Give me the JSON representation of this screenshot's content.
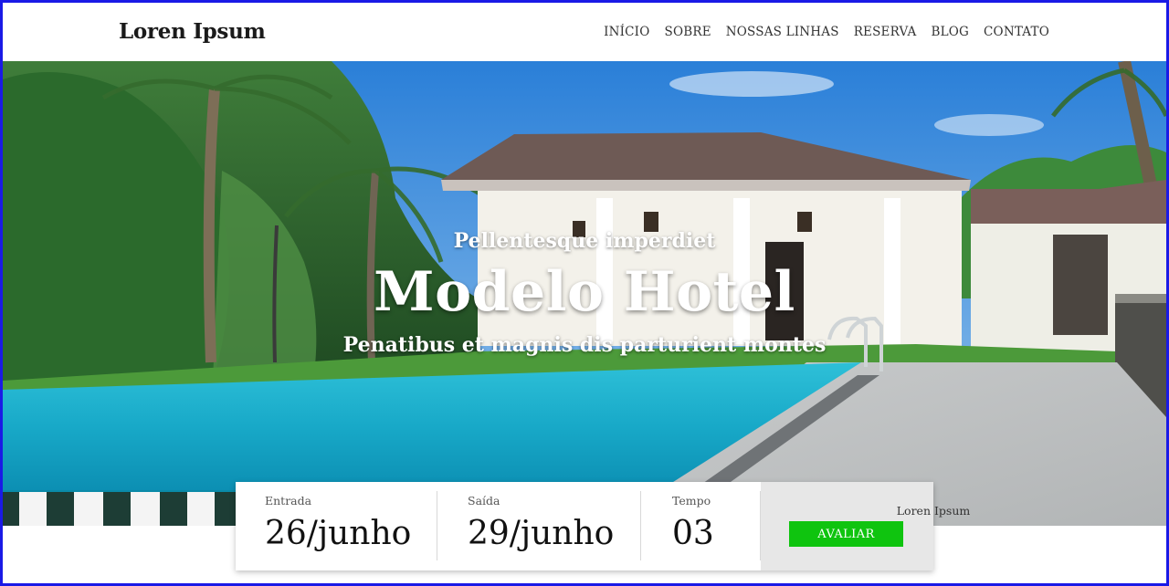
{
  "header": {
    "logo": "Loren Ipsum",
    "nav": [
      "INÍCIO",
      "SOBRE",
      "NOSSAS LINHAS",
      "RESERVA",
      "BLOG",
      "CONTATO"
    ]
  },
  "hero": {
    "subtitle_top": "Pellentesque imperdiet",
    "title": "Modelo Hotel",
    "subtitle_bottom": "Penatibus et magnis dis parturient montes"
  },
  "booking": {
    "checkin_label": "Entrada",
    "checkin_value": "26/junho",
    "checkout_label": "Saída",
    "checkout_value": "29/junho",
    "duration_label": "Tempo",
    "duration_value": "03",
    "cta_label": "Loren Ipsum",
    "cta_button": "AVALIAR"
  },
  "colors": {
    "frame_border": "#1a1ae6",
    "button": "#0fc40f",
    "widget_accent_bg": "#e7e7e7"
  }
}
